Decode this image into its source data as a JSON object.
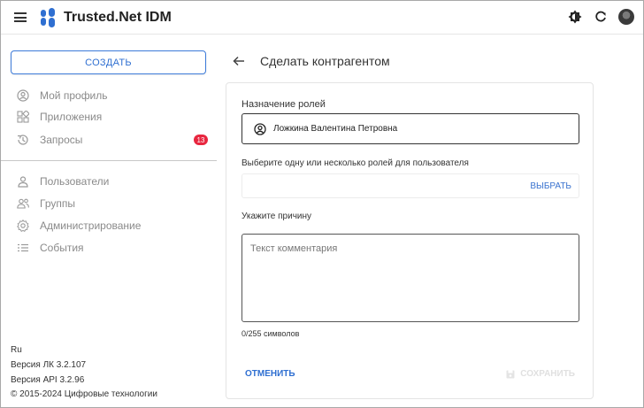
{
  "app": {
    "title": "Trusted.Net IDM",
    "accent_color": "#2f6fd1",
    "icons": [
      "menu-icon",
      "theme-icon",
      "refresh-icon",
      "avatar"
    ]
  },
  "sidebar": {
    "create_label": "СОЗДАТЬ",
    "items": [
      {
        "label": "Мой профиль",
        "icon": "profile-icon"
      },
      {
        "label": "Приложения",
        "icon": "apps-icon"
      },
      {
        "label": "Запросы",
        "icon": "history-icon",
        "badge": "13"
      },
      {
        "label": "Пользователи",
        "icon": "user-icon"
      },
      {
        "label": "Группы",
        "icon": "group-icon"
      },
      {
        "label": "Администрирование",
        "icon": "settings-icon"
      },
      {
        "label": "События",
        "icon": "events-icon"
      }
    ],
    "footer": {
      "lang": "Ru",
      "version_lk": "Версия ЛК 3.2.107",
      "version_api": "Версия API 3.2.96",
      "copyright": "© 2015-2024 Цифровые технологии"
    }
  },
  "main": {
    "title": "Сделать контрагентом",
    "form": {
      "roles_label": "Назначение ролей",
      "person_name": "Ложкина Валентина Петровна",
      "select_label": "Выберите одну или несколько ролей для пользователя",
      "select_button": "ВЫБРАТЬ",
      "reason_label": "Укажите причину",
      "comment_placeholder": "Текст комментария",
      "comment_value": "",
      "counter": "0/255 символов",
      "cancel_label": "ОТМЕНИТЬ",
      "save_label": "СОХРАНИТЬ"
    }
  }
}
